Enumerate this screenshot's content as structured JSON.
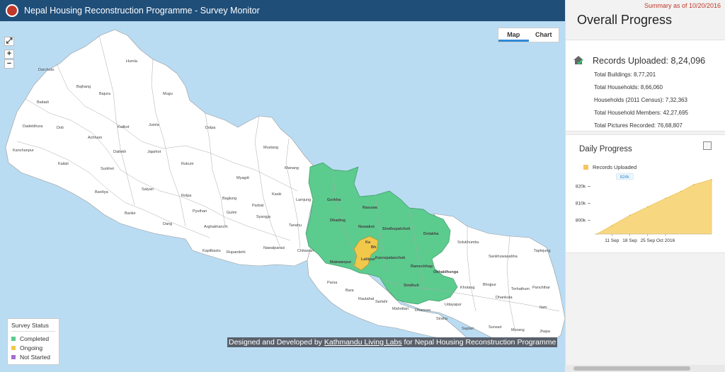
{
  "header": {
    "title": "Nepal Housing Reconstruction Programme - Survey Monitor"
  },
  "map": {
    "zoom_in": "+",
    "zoom_out": "−",
    "tabs": [
      {
        "label": "Map",
        "active": true
      },
      {
        "label": "Chart",
        "active": false
      }
    ],
    "district_labels": [
      "Darchula",
      "Humla",
      "Bajhang",
      "Bajura",
      "Mugu",
      "Baitadi",
      "Doti",
      "Kalikot",
      "Jumla",
      "Dolpa",
      "Dadeldhura",
      "Achham",
      "Kanchanpur",
      "Kailali",
      "Dailekh",
      "Jajarkot",
      "Surkhet",
      "Rukum",
      "Mustang",
      "Manang",
      "Bardiya",
      "Salyan",
      "Rolpa",
      "Myagdi",
      "Kaski",
      "Lamjung",
      "Gorkha",
      "Rasuwa",
      "Banke",
      "Dang",
      "Pyuthan",
      "Baglung",
      "Gulmi",
      "Parbat",
      "Syangja",
      "Tanahu",
      "Dhading",
      "Nuwakot",
      "Sindhupalchok",
      "Dolakha",
      "Arghakhanchi",
      "Kapilbastu",
      "Rupandehi",
      "Nawalparasi",
      "Chitawan",
      "Makwanpur",
      "Lalitpur",
      "Kavrepalanchok",
      "Ramechhap",
      "Okhaldhunga",
      "Solukhumbu",
      "Sankhuwasabha",
      "Taplejung",
      "Parsa",
      "Bara",
      "Rautahat",
      "Sarlahi",
      "Sindhuli",
      "Mahottari",
      "Dhanusa",
      "Siraha",
      "Saptari",
      "Udayapur",
      "Khotang",
      "Bhojpur",
      "Dhankuta",
      "Terhathum",
      "Panchthar",
      "Ilam",
      "Sunsari",
      "Morang",
      "Jhapa",
      "Ka",
      "Bh"
    ],
    "colors": {
      "completed": "#5ccb8e",
      "ongoing": "#f2c84b",
      "not_started": "#a36fd0",
      "water": "#b9dcf3"
    }
  },
  "legend": {
    "title": "Survey Status",
    "items": [
      {
        "label": "Completed",
        "color": "#5ccb8e"
      },
      {
        "label": "Ongoing",
        "color": "#f2c84b"
      },
      {
        "label": "Not Started",
        "color": "#a36fd0"
      }
    ]
  },
  "credit": {
    "prefix": "Designed and Developed by ",
    "link": "Kathmandu Living Labs",
    "suffix": " for Nepal Housing Reconstruction Programme"
  },
  "panel": {
    "summary_date": "Summary as of 10/20/2016",
    "title": "Overall Progress",
    "records_uploaded": "Records Uploaded: 8,24,096",
    "stats": [
      "Total Buildings: 8,77,201",
      "Total Households: 8,66,060",
      "Households (2011 Census): 7,32,363",
      "Total Household Members: 42,27,695",
      "Total Pictures Recorded: 76,68,807"
    ],
    "daily_title": "Daily Progress"
  },
  "chart_data": {
    "type": "area",
    "series": [
      {
        "name": "Records Uploaded",
        "x": [
          "2016-09-05",
          "2016-09-11",
          "2016-09-18",
          "2016-09-25",
          "2016-10-02",
          "2016-10-08",
          "2016-10-13",
          "2016-10-20"
        ],
        "values": [
          792,
          797,
          803,
          808,
          813,
          817,
          821,
          824
        ]
      }
    ],
    "ytick_labels": [
      "800k",
      "810k",
      "820k"
    ],
    "yticks": [
      800,
      810,
      820
    ],
    "xtick_labels": [
      "11 Sep",
      "18 Sep",
      "25 Sep",
      "Oct 2016"
    ],
    "xticks": [
      "2016-09-11",
      "2016-09-18",
      "2016-09-25",
      "2016-10-02"
    ],
    "tooltip": "824k",
    "ylim": [
      792,
      826
    ],
    "xlim": [
      "2016-09-04",
      "2016-10-20"
    ],
    "color": "#f8d781",
    "legend_position": "top-left"
  }
}
